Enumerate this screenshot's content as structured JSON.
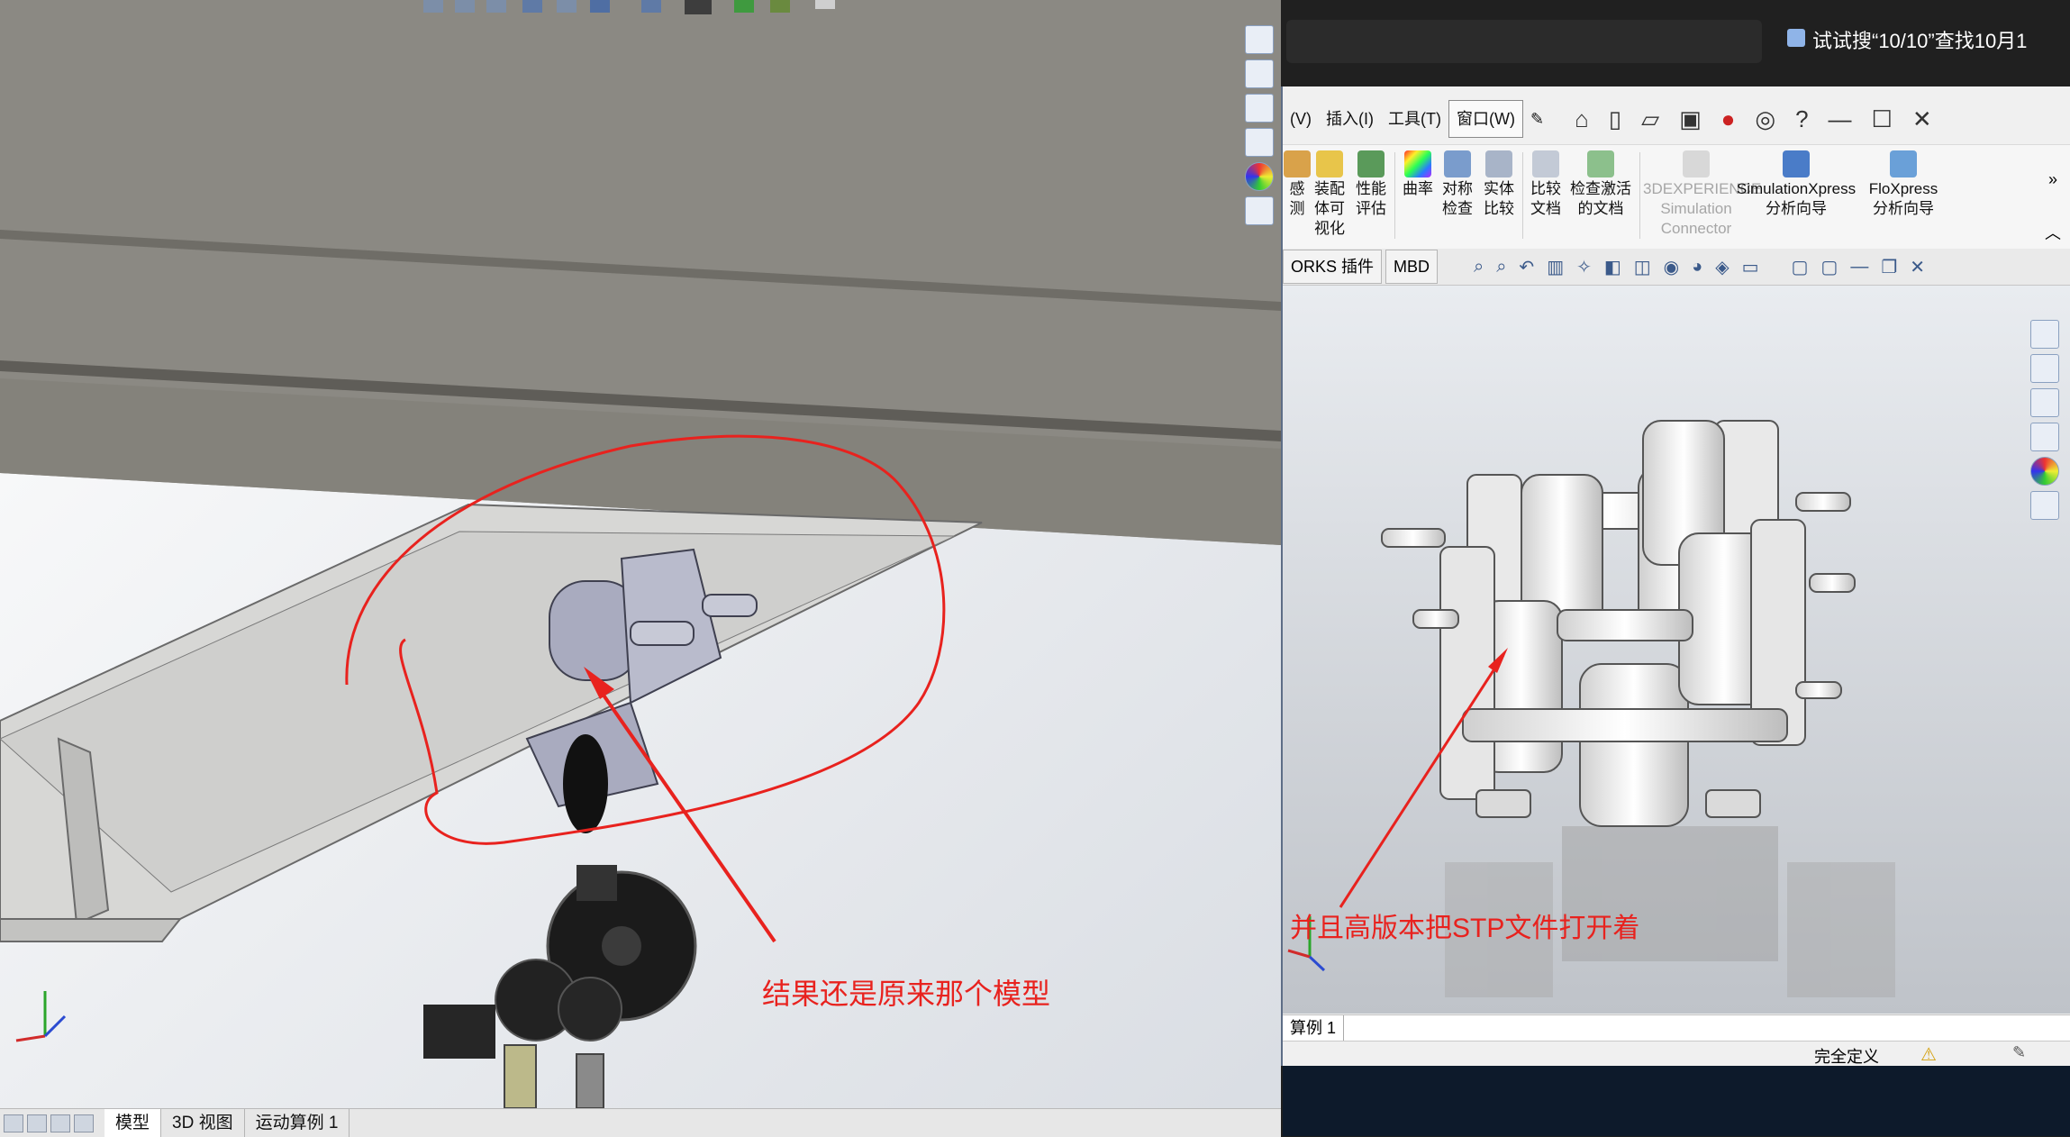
{
  "left_window": {
    "bottom_tabs": [
      "模型",
      "3D 视图",
      "运动算例 1"
    ],
    "active_tab": "模型"
  },
  "right_window": {
    "taskbar_search_hint": "试试搜“10/10”查找10月1",
    "menus": [
      "(V)",
      "插入(I)",
      "工具(T)",
      "窗口(W)"
    ],
    "active_menu": "窗口(W)",
    "ribbon": [
      {
        "label": "感\n测",
        "icon": "sensor-icon"
      },
      {
        "label": "装配\n体可\n视化",
        "icon": "assembly-visualization-icon"
      },
      {
        "label": "性能\n评估",
        "icon": "performance-evaluation-icon"
      },
      {
        "label": "曲率",
        "icon": "curvature-icon"
      },
      {
        "label": "对称\n检查",
        "icon": "symmetry-check-icon"
      },
      {
        "label": "实体\n比较",
        "icon": "body-compare-icon"
      },
      {
        "label": "比较\n文档",
        "icon": "compare-documents-icon"
      },
      {
        "label": "检查激活\n的文档",
        "icon": "check-active-document-icon"
      },
      {
        "label": "3DEXPERIENCE\nSimulation\nConnector",
        "icon": "simulation-connector-icon",
        "disabled": true
      },
      {
        "label": "SimulationXpress\n分析向导",
        "icon": "simulationxpress-icon"
      },
      {
        "label": "FloXpress\n分析向导",
        "icon": "floxpress-icon"
      }
    ],
    "command_tabs": [
      "ORKS 插件",
      "MBD"
    ],
    "bottom_tab": "算例 1",
    "status": "完全定义"
  },
  "annotations": {
    "left": "结果还是原来那个模型",
    "right": "并且高版本把STP文件打开着"
  },
  "colors": {
    "annotation_red": "#e8221e",
    "steel_gray": "#8d8b84",
    "viewport_gray": "#c9cdd4"
  }
}
